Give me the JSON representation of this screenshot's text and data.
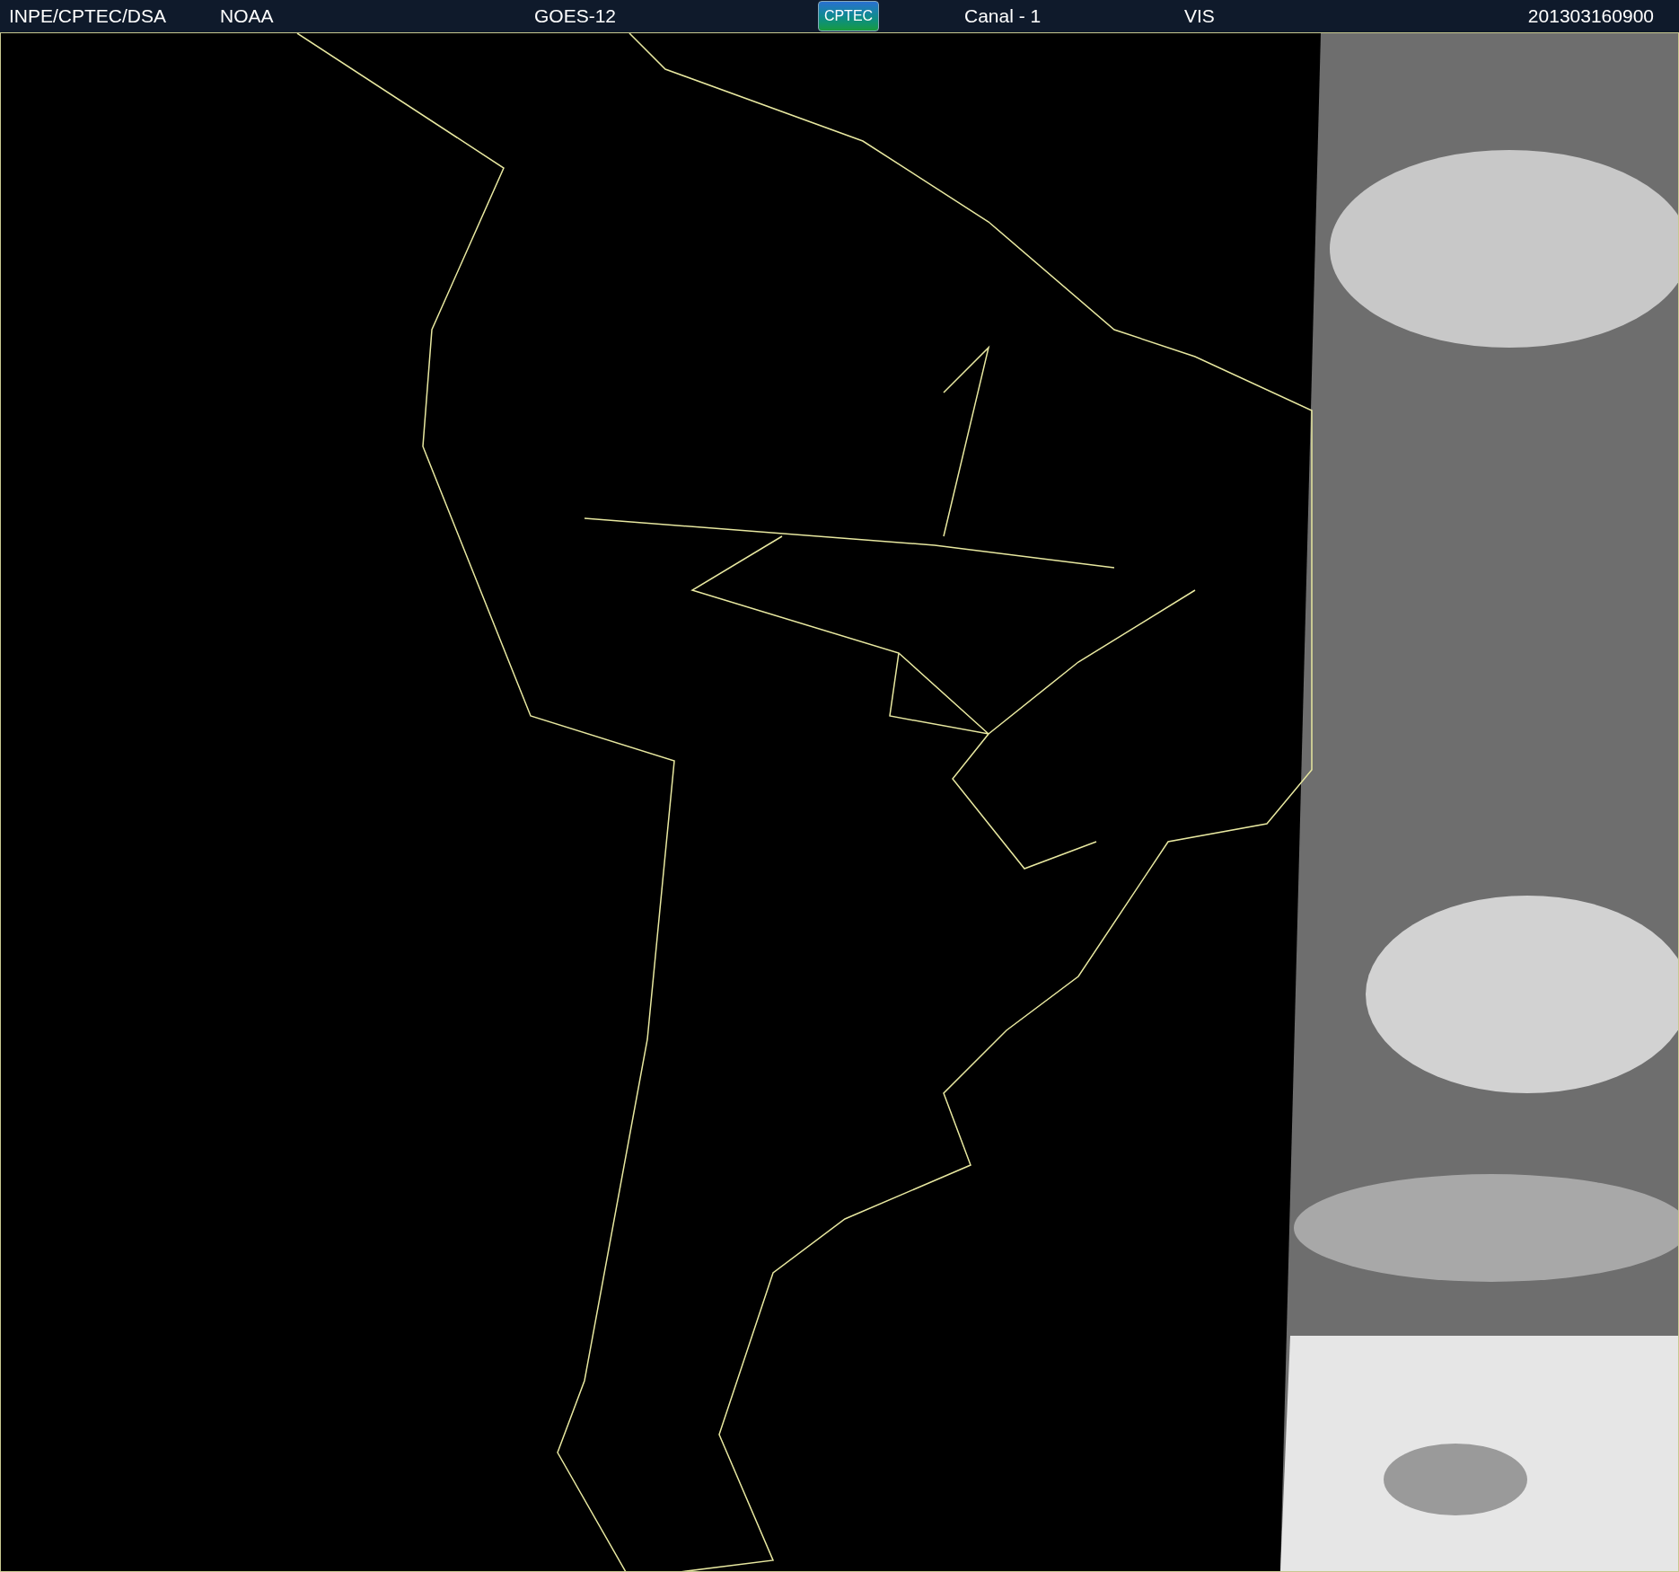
{
  "header": {
    "source": "INPE/CPTEC/DSA",
    "agency": "NOAA",
    "satellite": "GOES-12",
    "logo": "CPTEC",
    "channel": "Canal - 1",
    "band": "VIS",
    "timestamp": "201303160900"
  }
}
